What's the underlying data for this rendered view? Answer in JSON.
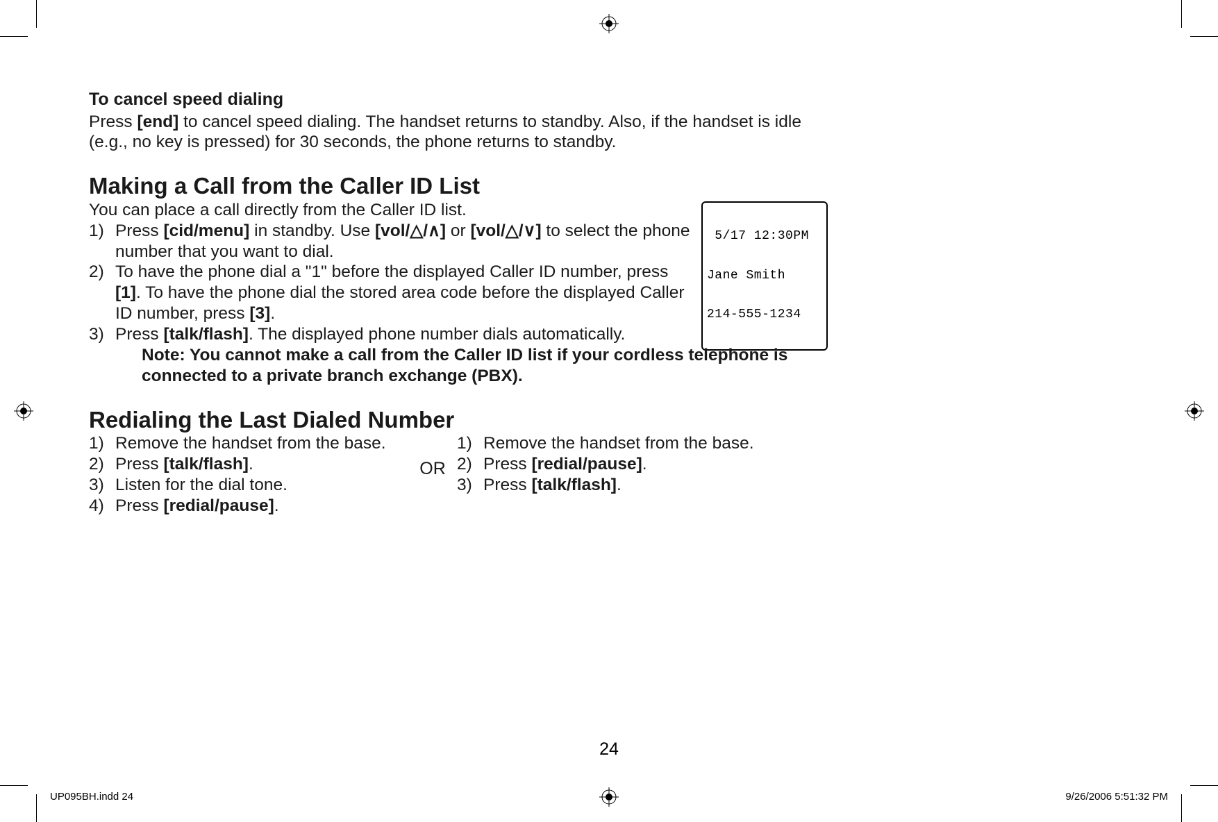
{
  "cancel": {
    "heading": "To cancel speed dialing",
    "body_pre": "Press ",
    "key": "[end]",
    "body_post": " to cancel speed dialing. The handset returns to standby. Also, if the handset is idle (e.g., no key is pressed) for 30 seconds, the phone returns to standby."
  },
  "caller_id": {
    "heading": "Making a Call from the Caller ID List",
    "intro": "You can place a call directly from the Caller ID list.",
    "steps": [
      {
        "marker": "1)",
        "pre": "Press ",
        "k1": "[cid/menu]",
        "mid1": " in standby. Use ",
        "k2": "[vol/△/∧]",
        "mid2": " or ",
        "k3": "[vol/△/∨]",
        "post": " to select the phone number that you want to dial."
      },
      {
        "marker": "2)",
        "pre": "To have the phone dial a \"1\" before the displayed Caller ID number, press ",
        "k1": "[1]",
        "mid1": ". To have the phone dial the stored area code before the displayed Caller ID number, press ",
        "k2": "[3]",
        "post": "."
      },
      {
        "marker": "3)",
        "pre": "Press ",
        "k1": "[talk/flash]",
        "post": ". The displayed phone number dials automatically."
      }
    ],
    "note": "Note: You cannot make a call from the Caller ID list if your cordless telephone is connected to a private branch exchange (PBX)."
  },
  "lcd": {
    "line1": " 5/17 12:30PM",
    "line2": "Jane Smith",
    "line3": "214-555-1234"
  },
  "redial": {
    "heading": "Redialing the Last Dialed Number",
    "left": [
      {
        "marker": "1)",
        "text": "Remove the handset from the base."
      },
      {
        "marker": "2)",
        "pre": "Press ",
        "k1": "[talk/flash]",
        "post": "."
      },
      {
        "marker": "3)",
        "text": "Listen for the dial tone."
      },
      {
        "marker": "4)",
        "pre": "Press ",
        "k1": "[redial/pause]",
        "post": "."
      }
    ],
    "or": "OR",
    "right": [
      {
        "marker": "1)",
        "text": "Remove the handset from the base."
      },
      {
        "marker": "2)",
        "pre": "Press ",
        "k1": "[redial/pause]",
        "post": "."
      },
      {
        "marker": "3)",
        "pre": "Press ",
        "k1": "[talk/flash]",
        "post": "."
      }
    ]
  },
  "page_number": "24",
  "footer": {
    "left": "UP095BH.indd   24",
    "right": "9/26/2006   5:51:32 PM"
  }
}
